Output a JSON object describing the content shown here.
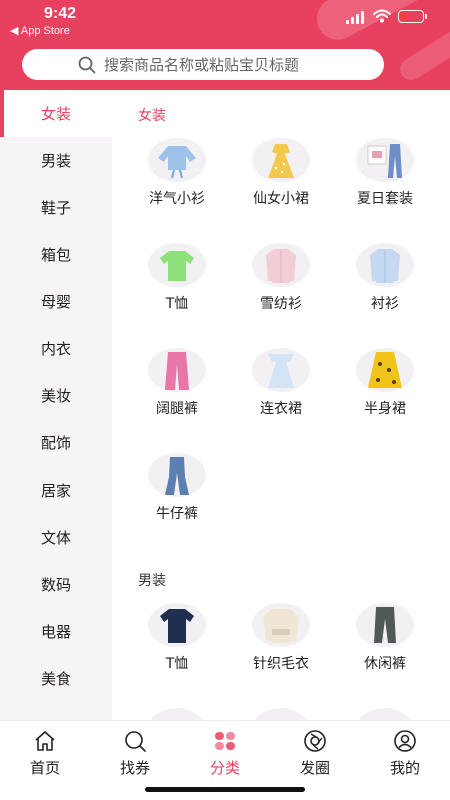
{
  "status": {
    "time": "9:42",
    "back_label": "◀ App Store"
  },
  "search": {
    "placeholder": "搜索商品名称或粘贴宝贝标题"
  },
  "sidebar": {
    "items": [
      {
        "label": "女装",
        "active": true
      },
      {
        "label": "男装"
      },
      {
        "label": "鞋子"
      },
      {
        "label": "箱包"
      },
      {
        "label": "母婴"
      },
      {
        "label": "内衣"
      },
      {
        "label": "美妆"
      },
      {
        "label": "配饰"
      },
      {
        "label": "居家"
      },
      {
        "label": "文体"
      },
      {
        "label": "数码"
      },
      {
        "label": "电器"
      },
      {
        "label": "美食"
      }
    ]
  },
  "sections": [
    {
      "title": "女装",
      "items": [
        {
          "label": "洋气小衫",
          "icon": "blue-blouse-icon",
          "color": "#9fc3e8"
        },
        {
          "label": "仙女小裙",
          "icon": "yellow-dress-icon",
          "color": "#f2c94c"
        },
        {
          "label": "夏日套装",
          "icon": "summer-outfit-icon",
          "color": "#6d8fc7"
        },
        {
          "label": "T恤",
          "icon": "green-tshirt-icon",
          "color": "#8ee07a"
        },
        {
          "label": "雪纺衫",
          "icon": "pink-chiffon-shirt-icon",
          "color": "#f2cdd6"
        },
        {
          "label": "衬衫",
          "icon": "blue-shirt-icon",
          "color": "#c4d8f2"
        },
        {
          "label": "阔腿裤",
          "icon": "pink-wide-pants-icon",
          "color": "#e877a8"
        },
        {
          "label": "连衣裙",
          "icon": "light-dress-icon",
          "color": "#d3e4f6"
        },
        {
          "label": "半身裙",
          "icon": "floral-skirt-icon",
          "color": "#f0c419"
        },
        {
          "label": "牛仔裤",
          "icon": "jeans-icon",
          "color": "#5a7fb0"
        }
      ]
    },
    {
      "title": "男装",
      "items": [
        {
          "label": "T恤",
          "icon": "navy-tshirt-icon",
          "color": "#1f2f4f"
        },
        {
          "label": "针织毛衣",
          "icon": "knit-sweater-icon",
          "color": "#efe6d6"
        },
        {
          "label": "休闲裤",
          "icon": "jogger-pants-icon",
          "color": "#4f5a58"
        }
      ]
    }
  ],
  "tabbar": {
    "items": [
      {
        "label": "首页",
        "icon": "home-icon"
      },
      {
        "label": "找券",
        "icon": "coupon-search-icon"
      },
      {
        "label": "分类",
        "icon": "category-icon",
        "active": true
      },
      {
        "label": "发圈",
        "icon": "camera-circle-icon"
      },
      {
        "label": "我的",
        "icon": "profile-icon"
      }
    ]
  },
  "colors": {
    "accent": "#e8405f",
    "sidebar_bg": "#f6f4f7"
  }
}
